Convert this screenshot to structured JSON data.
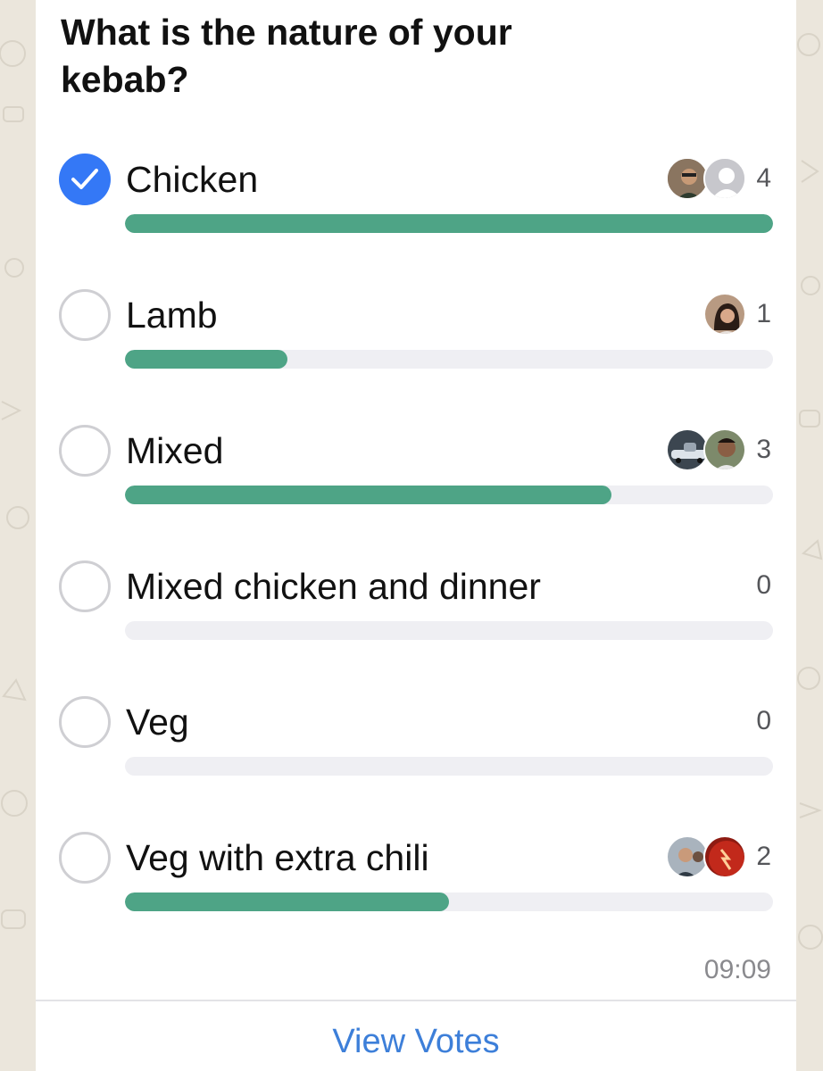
{
  "poll": {
    "question": "What is the nature of your kebab?",
    "options": [
      {
        "label": "Chicken",
        "votes": "4",
        "fraction": 1.0,
        "selected": true
      },
      {
        "label": "Lamb",
        "votes": "1",
        "fraction": 0.25,
        "selected": false
      },
      {
        "label": "Mixed",
        "votes": "3",
        "fraction": 0.75,
        "selected": false
      },
      {
        "label": "Mixed chicken and dinner",
        "votes": "0",
        "fraction": 0,
        "selected": false
      },
      {
        "label": "Veg",
        "votes": "0",
        "fraction": 0,
        "selected": false
      },
      {
        "label": "Veg with extra chili",
        "votes": "2",
        "fraction": 0.5,
        "selected": false
      }
    ],
    "time": "09:09",
    "view_votes_label": "View Votes"
  },
  "colors": {
    "accent_blue": "#3478f6",
    "bar_fill": "#4ea486",
    "bar_track": "#efeff3",
    "link": "#3d7fd9"
  }
}
